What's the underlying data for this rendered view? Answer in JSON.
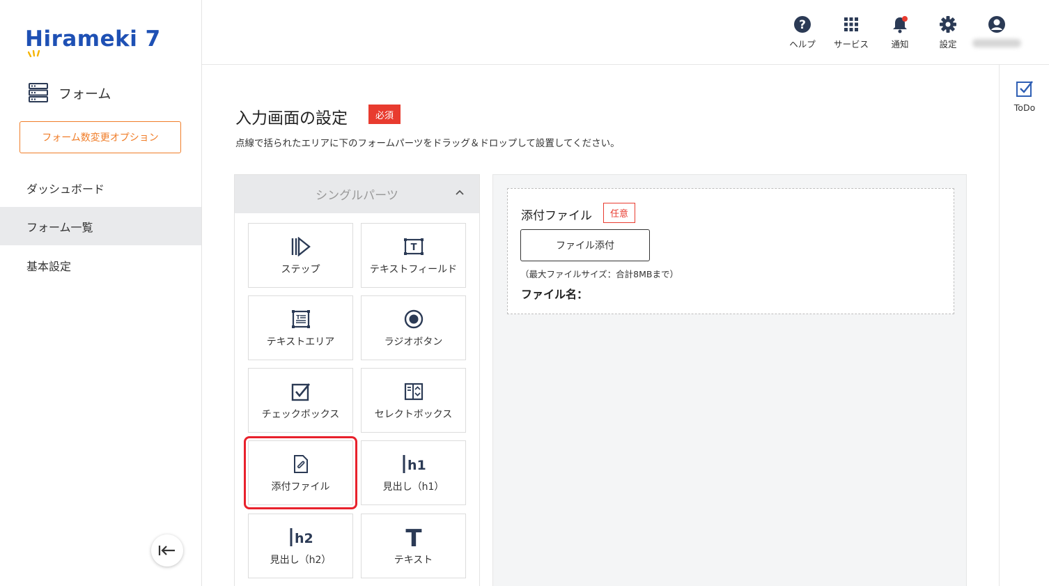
{
  "brand": {
    "logo_text": "Hirameki 7",
    "accent": "#1e50b4"
  },
  "sidebar": {
    "section_label": "フォーム",
    "option_button": "フォーム数変更オプション",
    "items": [
      {
        "label": "ダッシュボード",
        "active": false
      },
      {
        "label": "フォーム一覧",
        "active": true
      },
      {
        "label": "基本設定",
        "active": false
      }
    ],
    "collapse_icon": "collapse-left-icon"
  },
  "header": {
    "items": [
      {
        "label": "ヘルプ",
        "icon": "help-icon"
      },
      {
        "label": "サービス",
        "icon": "grid-icon"
      },
      {
        "label": "通知",
        "icon": "bell-icon"
      },
      {
        "label": "設定",
        "icon": "gear-icon"
      }
    ],
    "user_icon": "user-icon"
  },
  "rail": {
    "todo_label": "ToDo"
  },
  "main": {
    "title": "入力画面の設定",
    "required_badge": "必須",
    "subtitle": "点線で括られたエリアに下のフォームパーツをドラッグ＆ドロップして設置してください。",
    "parts_header": "シングルパーツ",
    "parts": [
      {
        "label": "ステップ",
        "icon": "step-icon"
      },
      {
        "label": "テキストフィールド",
        "icon": "text-field-icon"
      },
      {
        "label": "テキストエリア",
        "icon": "text-area-icon"
      },
      {
        "label": "ラジオボタン",
        "icon": "radio-icon"
      },
      {
        "label": "チェックボックス",
        "icon": "checkbox-icon"
      },
      {
        "label": "セレクトボックス",
        "icon": "select-box-icon"
      },
      {
        "label": "添付ファイル",
        "icon": "attachment-icon",
        "highlighted": true
      },
      {
        "label": "見出し（h1）",
        "icon": "h1-icon",
        "icon_text": "h1"
      },
      {
        "label": "見出し（h2）",
        "icon": "h2-icon",
        "icon_text": "h2"
      },
      {
        "label": "テキスト",
        "icon": "text-icon",
        "icon_text": "T"
      }
    ]
  },
  "canvas": {
    "field_label": "添付ファイル",
    "optional_badge": "任意",
    "attach_button": "ファイル添付",
    "max_note": "（最大ファイルサイズ：合計8MBまで）",
    "filename_label": "ファイル名："
  },
  "colors": {
    "orange": "#f07d28",
    "red": "#e83b2f",
    "highlight": "#e8212c"
  }
}
